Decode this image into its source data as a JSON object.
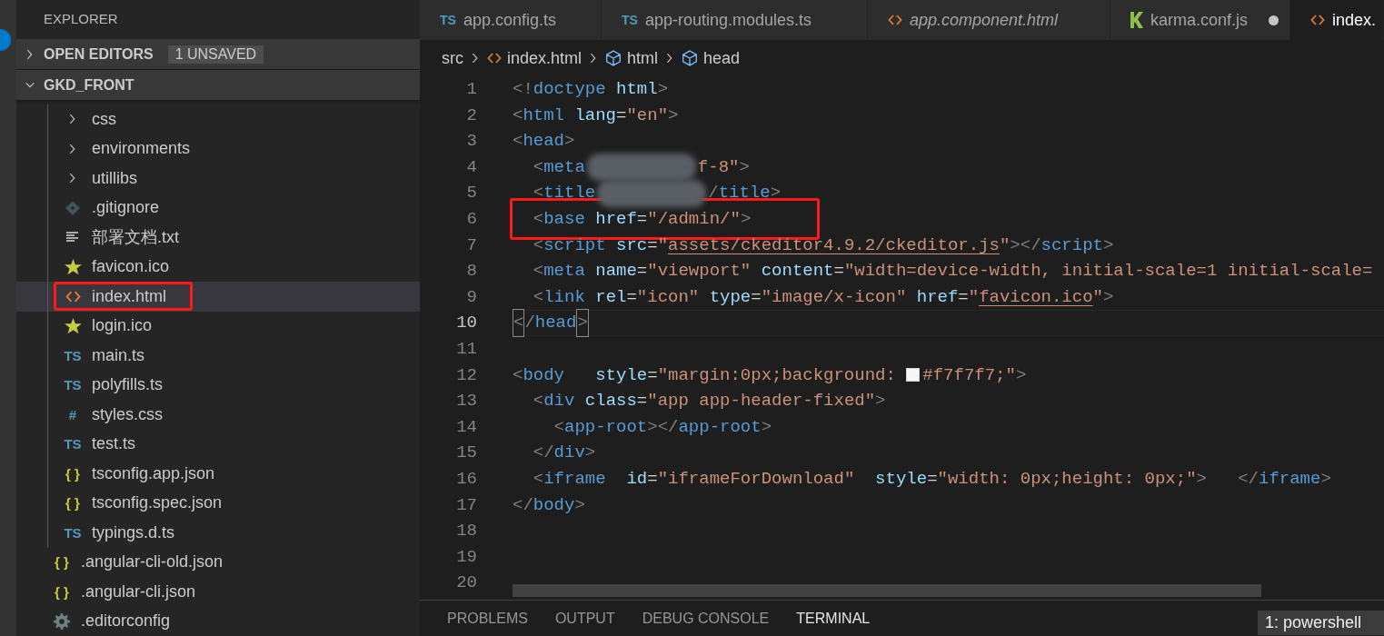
{
  "sidebar": {
    "title": "EXPLORER",
    "sections": [
      {
        "label": "OPEN EDITORS",
        "expanded": false,
        "badge": "1 UNSAVED"
      },
      {
        "label": "GKD_FRONT",
        "expanded": true
      }
    ],
    "tree": [
      {
        "kind": "group",
        "children": [
          {
            "kind": "folder",
            "label": "css",
            "expanded": false,
            "selected": false
          },
          {
            "kind": "folder",
            "label": "environments",
            "expanded": false,
            "selected": false
          },
          {
            "kind": "folder",
            "label": "utillibs",
            "expanded": false,
            "selected": false
          },
          {
            "kind": "git",
            "label": ".gitignore",
            "selected": false
          },
          {
            "kind": "text",
            "label": "部署文档.txt",
            "selected": false
          },
          {
            "kind": "star",
            "label": "favicon.ico",
            "selected": false
          },
          {
            "kind": "html",
            "label": "index.html",
            "selected": true,
            "annotated": true
          },
          {
            "kind": "star",
            "label": "login.ico",
            "selected": false
          },
          {
            "kind": "glyph",
            "glyph": "TS",
            "label": "main.ts",
            "color": "#519aba",
            "selected": false
          },
          {
            "kind": "glyph",
            "glyph": "TS",
            "label": "polyfills.ts",
            "color": "#519aba",
            "selected": false
          },
          {
            "kind": "glyph",
            "glyph": "#",
            "label": "styles.css",
            "color": "#519aba",
            "selected": false
          },
          {
            "kind": "glyph",
            "glyph": "TS",
            "label": "test.ts",
            "color": "#519aba",
            "selected": false
          },
          {
            "kind": "glyph",
            "glyph": "{ }",
            "label": "tsconfig.app.json",
            "color": "#cbcb41",
            "selected": false
          },
          {
            "kind": "glyph",
            "glyph": "{ }",
            "label": "tsconfig.spec.json",
            "color": "#cbcb41",
            "selected": false
          },
          {
            "kind": "glyph",
            "glyph": "TS",
            "label": "typings.d.ts",
            "color": "#519aba",
            "selected": false
          }
        ]
      },
      {
        "kind": "glyph",
        "glyph": "{ }",
        "label": ".angular-cli-old.json",
        "color": "#cbcb41",
        "selected": false
      },
      {
        "kind": "glyph",
        "glyph": "{ }",
        "label": ".angular-cli.json",
        "color": "#cbcb41",
        "selected": false
      },
      {
        "kind": "gear",
        "label": ".editorconfig",
        "selected": false
      }
    ]
  },
  "tabs": [
    {
      "kind": "ts",
      "glyph": "TS",
      "label": "app.config.ts",
      "selected": false,
      "preview": false,
      "dirty": false
    },
    {
      "kind": "ts",
      "glyph": "TS",
      "label": "app-routing.modules.ts",
      "selected": false,
      "preview": false,
      "dirty": false
    },
    {
      "kind": "html",
      "label": "app.component.html",
      "selected": false,
      "preview": true,
      "dirty": false
    },
    {
      "kind": "karma",
      "label": "karma.conf.js",
      "selected": false,
      "preview": false,
      "dirty": true
    },
    {
      "kind": "html",
      "label": "index.",
      "selected": true,
      "preview": false,
      "dirty": false
    }
  ],
  "breadcrumbs": [
    {
      "kind": "folder",
      "label": "src"
    },
    {
      "kind": "html",
      "label": "index.html"
    },
    {
      "kind": "element",
      "label": "html"
    },
    {
      "kind": "element",
      "label": "head"
    }
  ],
  "editor": {
    "lines": [
      {
        "number": "1",
        "current": false,
        "tokens": [
          {
            "kind": "punct",
            "text": "<!"
          },
          {
            "kind": "tag",
            "text": "doctype"
          },
          {
            "kind": "attr",
            "text": " html"
          },
          {
            "kind": "punct",
            "text": ">"
          }
        ]
      },
      {
        "number": "2",
        "current": false,
        "tokens": [
          {
            "kind": "punct",
            "text": "<"
          },
          {
            "kind": "tag",
            "text": "html"
          },
          {
            "kind": "attr",
            "text": " lang"
          },
          {
            "kind": "text",
            "text": "="
          },
          {
            "kind": "str",
            "text": "\"en\""
          },
          {
            "kind": "punct",
            "text": ">"
          }
        ]
      },
      {
        "number": "3",
        "current": false,
        "tokens": [
          {
            "kind": "punct",
            "text": "<"
          },
          {
            "kind": "tag",
            "text": "head"
          },
          {
            "kind": "punct",
            "text": ">"
          }
        ]
      },
      {
        "number": "4",
        "current": false,
        "tokens": [
          {
            "kind": "punct",
            "text": "  <"
          },
          {
            "kind": "tag",
            "text": "meta"
          },
          {
            "kind": "redacted"
          },
          {
            "kind": "str",
            "text": "f-8\""
          },
          {
            "kind": "punct",
            "text": ">"
          }
        ]
      },
      {
        "number": "5",
        "current": false,
        "tokens": [
          {
            "kind": "punct",
            "text": "  <"
          },
          {
            "kind": "tag",
            "text": "title"
          },
          {
            "kind": "redacted"
          },
          {
            "kind": "punct",
            "text": "/"
          },
          {
            "kind": "tag",
            "text": "title"
          },
          {
            "kind": "punct",
            "text": ">"
          }
        ]
      },
      {
        "number": "6",
        "current": false,
        "annotated": true,
        "tokens": [
          {
            "kind": "punct",
            "text": "  <"
          },
          {
            "kind": "tag",
            "text": "base"
          },
          {
            "kind": "attr",
            "text": " href"
          },
          {
            "kind": "text",
            "text": "="
          },
          {
            "kind": "str",
            "text": "\"/admin/\""
          },
          {
            "kind": "punct",
            "text": ">"
          }
        ]
      },
      {
        "number": "7",
        "current": false,
        "tokens": [
          {
            "kind": "punct",
            "text": "  <"
          },
          {
            "kind": "tag",
            "text": "script"
          },
          {
            "kind": "attr",
            "text": " src"
          },
          {
            "kind": "text",
            "text": "="
          },
          {
            "kind": "str",
            "text": "\""
          },
          {
            "kind": "link",
            "text": "assets/ckeditor4.9.2/ckeditor.js"
          },
          {
            "kind": "str",
            "text": "\""
          },
          {
            "kind": "punct",
            "text": "></"
          },
          {
            "kind": "tag",
            "text": "script"
          },
          {
            "kind": "punct",
            "text": ">"
          }
        ]
      },
      {
        "number": "8",
        "current": false,
        "tokens": [
          {
            "kind": "punct",
            "text": "  <"
          },
          {
            "kind": "tag",
            "text": "meta"
          },
          {
            "kind": "attr",
            "text": " name"
          },
          {
            "kind": "text",
            "text": "="
          },
          {
            "kind": "str",
            "text": "\"viewport\""
          },
          {
            "kind": "attr",
            "text": " content"
          },
          {
            "kind": "text",
            "text": "="
          },
          {
            "kind": "str",
            "text": "\"width=device-width, initial-scale=1 initial-scale="
          }
        ]
      },
      {
        "number": "9",
        "current": false,
        "tokens": [
          {
            "kind": "punct",
            "text": "  <"
          },
          {
            "kind": "tag",
            "text": "link"
          },
          {
            "kind": "attr",
            "text": " rel"
          },
          {
            "kind": "text",
            "text": "="
          },
          {
            "kind": "str",
            "text": "\"icon\""
          },
          {
            "kind": "attr",
            "text": " type"
          },
          {
            "kind": "text",
            "text": "="
          },
          {
            "kind": "str",
            "text": "\"image/x-icon\""
          },
          {
            "kind": "attr",
            "text": " href"
          },
          {
            "kind": "text",
            "text": "="
          },
          {
            "kind": "str",
            "text": "\""
          },
          {
            "kind": "link",
            "text": "favicon.ico"
          },
          {
            "kind": "str",
            "text": "\""
          },
          {
            "kind": "punct",
            "text": ">"
          }
        ]
      },
      {
        "number": "10",
        "current": true,
        "tokens": [
          {
            "kind": "bracket",
            "text": "<"
          },
          {
            "kind": "punct",
            "text": "/"
          },
          {
            "kind": "tag",
            "text": "head"
          },
          {
            "kind": "bracket",
            "text": ">"
          }
        ]
      },
      {
        "number": "11",
        "current": false
      },
      {
        "number": "12",
        "current": false,
        "tokens": [
          {
            "kind": "punct",
            "text": "<"
          },
          {
            "kind": "tag",
            "text": "body"
          },
          {
            "kind": "attr",
            "text": "   style"
          },
          {
            "kind": "text",
            "text": "="
          },
          {
            "kind": "str",
            "text": "\"margin:0px;background: "
          },
          {
            "kind": "swatch",
            "color": "#f7f7f7"
          },
          {
            "kind": "str",
            "text": "#f7f7f7;\""
          },
          {
            "kind": "punct",
            "text": ">"
          }
        ]
      },
      {
        "number": "13",
        "current": false,
        "tokens": [
          {
            "kind": "punct",
            "text": "  <"
          },
          {
            "kind": "tag",
            "text": "div"
          },
          {
            "kind": "attr",
            "text": " class"
          },
          {
            "kind": "text",
            "text": "="
          },
          {
            "kind": "str",
            "text": "\"app app-header-fixed\""
          },
          {
            "kind": "punct",
            "text": ">"
          }
        ]
      },
      {
        "number": "14",
        "current": false,
        "tokens": [
          {
            "kind": "punct",
            "text": "    <"
          },
          {
            "kind": "tag",
            "text": "app-root"
          },
          {
            "kind": "punct",
            "text": "></"
          },
          {
            "kind": "tag",
            "text": "app-root"
          },
          {
            "kind": "punct",
            "text": ">"
          }
        ]
      },
      {
        "number": "15",
        "current": false,
        "tokens": [
          {
            "kind": "punct",
            "text": "  </"
          },
          {
            "kind": "tag",
            "text": "div"
          },
          {
            "kind": "punct",
            "text": ">"
          }
        ]
      },
      {
        "number": "16",
        "current": false,
        "tokens": [
          {
            "kind": "punct",
            "text": "  <"
          },
          {
            "kind": "tag",
            "text": "iframe"
          },
          {
            "kind": "attr",
            "text": "  id"
          },
          {
            "kind": "text",
            "text": "="
          },
          {
            "kind": "str",
            "text": "\"iframeForDownload\""
          },
          {
            "kind": "attr",
            "text": "  style"
          },
          {
            "kind": "text",
            "text": "="
          },
          {
            "kind": "str",
            "text": "\"width: 0px;height: 0px;\""
          },
          {
            "kind": "punct",
            "text": ">   </"
          },
          {
            "kind": "tag",
            "text": "iframe"
          },
          {
            "kind": "punct",
            "text": ">"
          }
        ]
      },
      {
        "number": "17",
        "current": false,
        "tokens": [
          {
            "kind": "punct",
            "text": "</"
          },
          {
            "kind": "tag",
            "text": "body"
          },
          {
            "kind": "punct",
            "text": ">"
          }
        ]
      },
      {
        "number": "18",
        "current": false
      },
      {
        "number": "19",
        "current": false
      },
      {
        "number": "20",
        "current": false
      }
    ]
  },
  "panel": {
    "tabs": [
      {
        "label": "PROBLEMS",
        "selected": false
      },
      {
        "label": "OUTPUT",
        "selected": false
      },
      {
        "label": "DEBUG CONSOLE",
        "selected": false
      },
      {
        "label": "TERMINAL",
        "selected": true
      }
    ],
    "terminal_select": "1: powershell"
  }
}
